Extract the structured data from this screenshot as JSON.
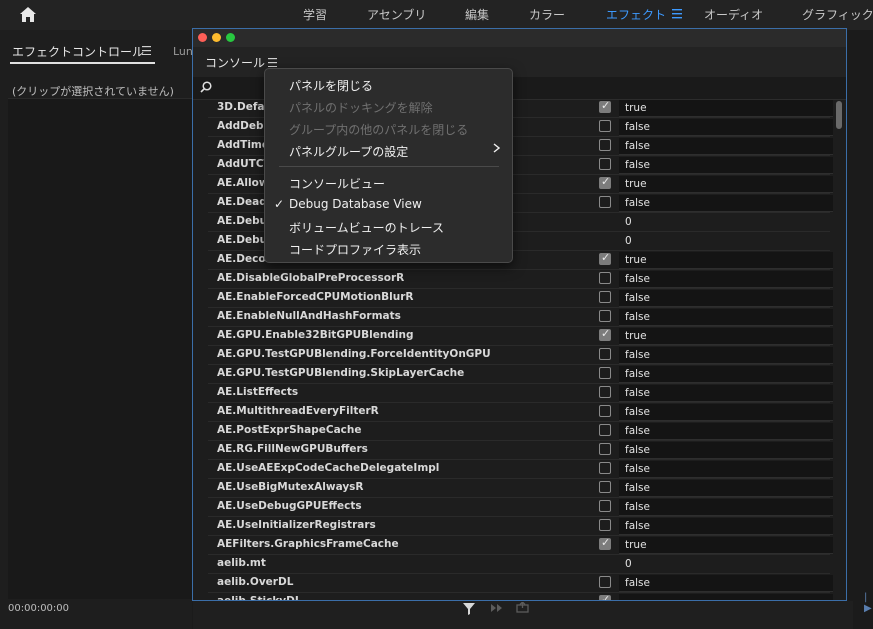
{
  "workspace": {
    "tabs": [
      {
        "label": "学習"
      },
      {
        "label": "アセンブリ"
      },
      {
        "label": "編集"
      },
      {
        "label": "カラー"
      },
      {
        "label": "エフェクト",
        "active": true
      },
      {
        "label": "オーディオ"
      },
      {
        "label": "グラフィック"
      }
    ],
    "accent_color": "#3d9aff"
  },
  "effects_panel": {
    "tab_label": "エフェクトコントロール",
    "second_tab_label": "Lun",
    "empty_message": "(クリップが選択されていません)",
    "timecode": "00:00:00:00"
  },
  "console": {
    "tab_label": "コンソール",
    "search_placeholder": "",
    "rows": [
      {
        "name": "3D.Defaul",
        "checked": true,
        "value": "true"
      },
      {
        "name": "AddDebug",
        "checked": false,
        "value": "false"
      },
      {
        "name": "AddTimes",
        "checked": false,
        "value": "false"
      },
      {
        "name": "AddUTCTi",
        "checked": false,
        "value": "false"
      },
      {
        "name": "AE.AllowD",
        "checked": true,
        "value": "true"
      },
      {
        "name": "AE.Deadlo",
        "checked": false,
        "value": "false"
      },
      {
        "name": "AE.Debug",
        "checked": null,
        "value": "0"
      },
      {
        "name": "AE.Debug",
        "checked": null,
        "value": "0"
      },
      {
        "name": "AE.Decode",
        "checked": true,
        "value": "true"
      },
      {
        "name": "AE.DisableGlobalPreProcessorR",
        "checked": false,
        "value": "false"
      },
      {
        "name": "AE.EnableForcedCPUMotionBlurR",
        "checked": false,
        "value": "false"
      },
      {
        "name": "AE.EnableNullAndHashFormats",
        "checked": false,
        "value": "false"
      },
      {
        "name": "AE.GPU.Enable32BitGPUBlending",
        "checked": true,
        "value": "true"
      },
      {
        "name": "AE.GPU.TestGPUBlending.ForceIdentityOnGPU",
        "checked": false,
        "value": "false"
      },
      {
        "name": "AE.GPU.TestGPUBlending.SkipLayerCache",
        "checked": false,
        "value": "false"
      },
      {
        "name": "AE.ListEffects",
        "checked": false,
        "value": "false"
      },
      {
        "name": "AE.MultithreadEveryFilterR",
        "checked": false,
        "value": "false"
      },
      {
        "name": "AE.PostExprShapeCache",
        "checked": false,
        "value": "false"
      },
      {
        "name": "AE.RG.FillNewGPUBuffers",
        "checked": false,
        "value": "false"
      },
      {
        "name": "AE.UseAEExpCodeCacheDelegateImpl",
        "checked": false,
        "value": "false"
      },
      {
        "name": "AE.UseBigMutexAlwaysR",
        "checked": false,
        "value": "false"
      },
      {
        "name": "AE.UseDebugGPUEffects",
        "checked": false,
        "value": "false"
      },
      {
        "name": "AE.UseInitializerRegistrars",
        "checked": false,
        "value": "false"
      },
      {
        "name": "AEFilters.GraphicsFrameCache",
        "checked": true,
        "value": "true"
      },
      {
        "name": "aelib.mt",
        "checked": null,
        "value": "0"
      },
      {
        "name": "aelib.OverDL",
        "checked": false,
        "value": "false"
      },
      {
        "name": "aelib.StickyDL",
        "checked": true,
        "value": ""
      }
    ]
  },
  "context_menu": {
    "items": [
      {
        "label": "パネルを閉じる",
        "enabled": true
      },
      {
        "label": "パネルのドッキングを解除",
        "enabled": false
      },
      {
        "label": "グループ内の他のパネルを閉じる",
        "enabled": false
      },
      {
        "label": "パネルグループの設定",
        "enabled": true,
        "submenu": true
      },
      {
        "label": "コンソールビュー",
        "enabled": true
      },
      {
        "label": "Debug Database View",
        "enabled": true,
        "checked": true
      },
      {
        "label": "ボリュームビューのトレース",
        "enabled": true
      },
      {
        "label": "コードプロファイラ表示",
        "enabled": true
      }
    ]
  }
}
